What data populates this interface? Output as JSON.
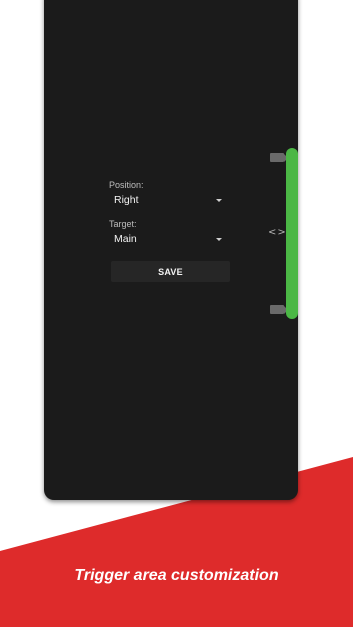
{
  "settings": {
    "position_label": "Position:",
    "position_value": "Right",
    "target_label": "Target:",
    "target_value": "Main",
    "save_label": "SAVE"
  },
  "trigger": {
    "arrows_text": "<>",
    "bar_color": "#4bb745"
  },
  "banner": {
    "caption": "Trigger area customization",
    "background_color": "#de2b2b"
  }
}
